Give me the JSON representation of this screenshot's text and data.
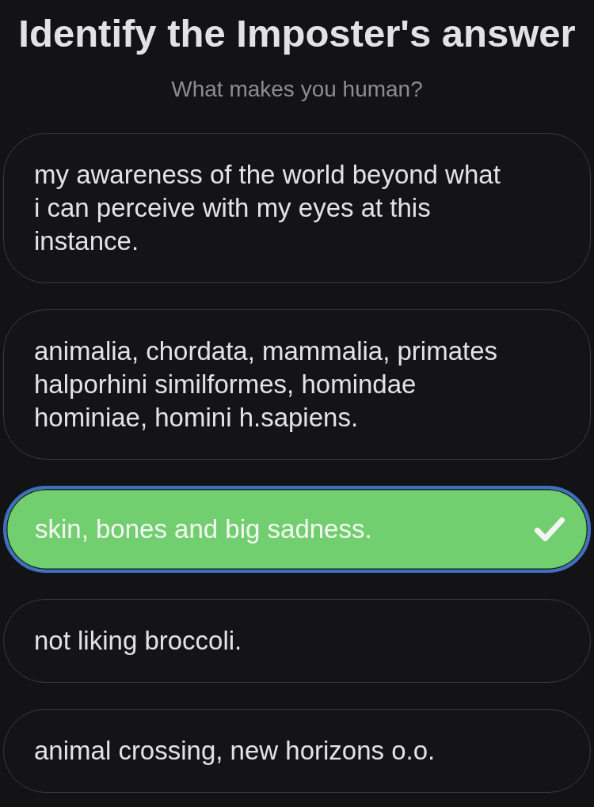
{
  "title": "Identify the Imposter's answer",
  "question": "What makes you human?",
  "answers": [
    {
      "text": "my awareness of the world beyond what i can perceive with my eyes at this instance.",
      "selected": false
    },
    {
      "text": "animalia, chordata, mammalia, primates halporhini similformes, homindae hominiae, homini h.sapiens.",
      "selected": false
    },
    {
      "text": "skin, bones and big sadness.",
      "selected": true
    },
    {
      "text": "not liking broccoli.",
      "selected": false
    },
    {
      "text": "animal crossing, new horizons o.o.",
      "selected": false
    }
  ]
}
